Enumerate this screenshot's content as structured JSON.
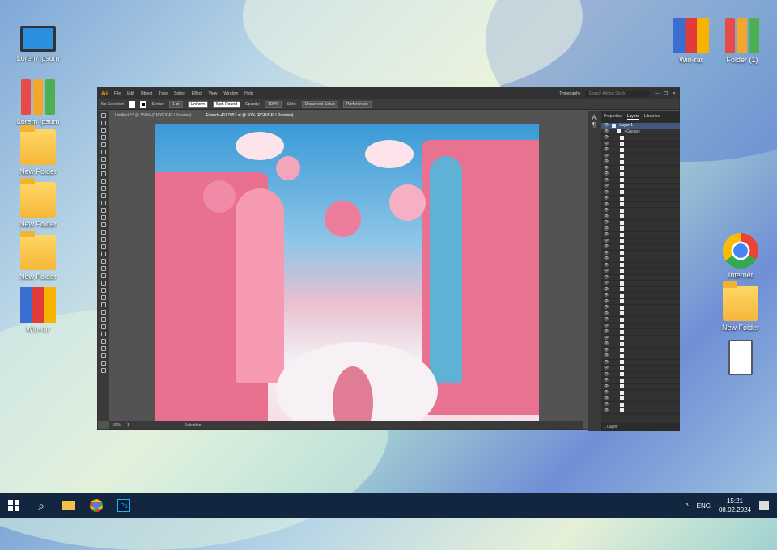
{
  "desktop": {
    "icons_left": [
      {
        "label": "Lorem Ipsum",
        "type": "computer"
      },
      {
        "label": "Lorem Ipsum",
        "type": "binders"
      },
      {
        "label": "New Folder",
        "type": "folder"
      },
      {
        "label": "New Folder",
        "type": "folder"
      },
      {
        "label": "New Folder",
        "type": "folder"
      },
      {
        "label": "Win-rar",
        "type": "winrar"
      }
    ],
    "icons_right": [
      {
        "label": "Win-rar",
        "type": "winrar"
      },
      {
        "label": "Folder (1)",
        "type": "binders"
      },
      {
        "label": "Internet",
        "type": "chrome"
      },
      {
        "label": "New Folder",
        "type": "folder"
      },
      {
        "label": ""
      }
    ]
  },
  "illustrator": {
    "logo": "Ai",
    "menu": [
      "File",
      "Edit",
      "Object",
      "Type",
      "Select",
      "Effect",
      "View",
      "Window",
      "Help"
    ],
    "workspace": "Typography",
    "search_placeholder": "Search Adobe Stock",
    "control": {
      "selection": "No Selection",
      "stroke_label": "Stroke:",
      "stroke_value": "1 pt",
      "profile": "Uniform",
      "brush": "5 pt. Round",
      "opacity_label": "Opacity:",
      "opacity": "100%",
      "style_label": "Style:",
      "document_setup": "Document Setup",
      "preferences": "Preferences"
    },
    "tabs": [
      {
        "label": "Untitled-1* @ 150% (CMYK/GPU Preview)",
        "active": false
      },
      {
        "label": "Friends-4187953.ai @ 50% (RGB/GPU Preview)",
        "active": true
      }
    ],
    "status": {
      "zoom": "50%",
      "artboard": "1",
      "tool": "Selection"
    },
    "panel": {
      "tabs": [
        "Properties",
        "Layers",
        "Libraries"
      ],
      "active_tab": "Layers",
      "layer": "Layer 1",
      "group": "<Group>",
      "footer": "1 Layer",
      "row_count": 46
    }
  },
  "taskbar": {
    "lang": "ENG",
    "time": "15:21",
    "date": "08.02.2024"
  }
}
